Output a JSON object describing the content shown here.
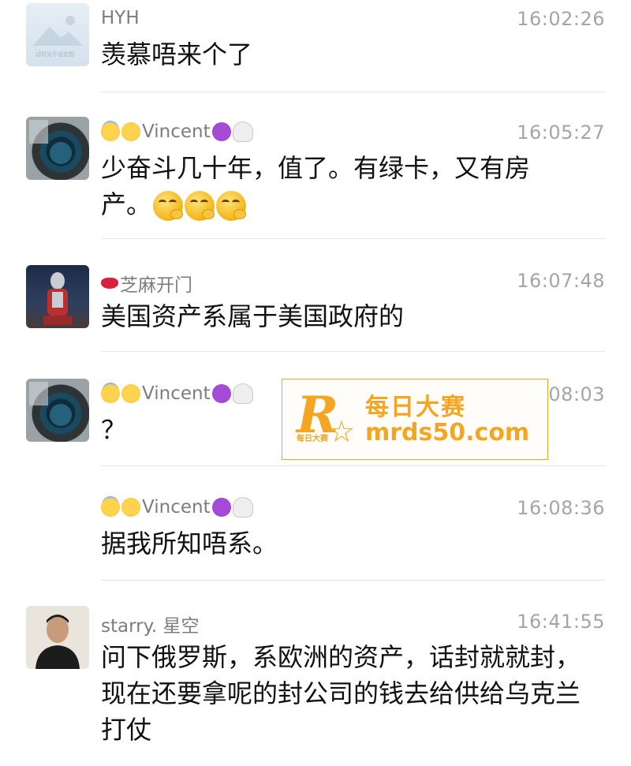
{
  "messages": [
    {
      "name": "HYH",
      "time": "16:02:26",
      "text": "羡慕唔来个了",
      "avatar_caption": "过时光不设定图"
    },
    {
      "name": "Vincent",
      "time": "16:05:27",
      "text": "少奋斗几十年，值了。有绿卡，又有房产。"
    },
    {
      "name": "芝麻开门",
      "time": "16:07:48",
      "text": "美国资产系属于美国政府的"
    },
    {
      "name": "Vincent",
      "time": "16:08:03",
      "text": "？"
    },
    {
      "name": "Vincent",
      "time": "16:08:36",
      "text": "据我所知唔系。"
    },
    {
      "name": "starry. 星空",
      "time": "16:41:55",
      "text": "问下俄罗斯，系欧洲的资产，话封就就封，现在还要拿呢的封公司的钱去给供给乌克兰打仗"
    }
  ],
  "watermark": {
    "logo_letter": "R",
    "logo_small": "每日大赛",
    "title": "每日大赛",
    "url": "mrds50.com"
  },
  "icons": {
    "name_prefix": [
      "halo-smile-emoji",
      "tongue-out-emoji"
    ],
    "name_suffix": [
      "devil-emoji",
      "ghost-emoji"
    ],
    "lips": "lips-emoji",
    "face_emoji": "face-with-hand-emoji"
  },
  "colors": {
    "name": "#7d7d7d",
    "time": "#a5a5a5",
    "watermark": "#f4a623"
  }
}
